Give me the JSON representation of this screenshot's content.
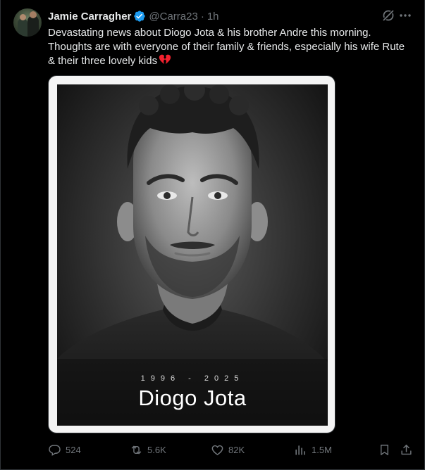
{
  "tweet": {
    "author_name": "Jamie Carragher",
    "handle": "@Carra23",
    "separator": "·",
    "time": "1h",
    "text": "Devastating news about Diogo Jota & his brother Andre this morning. Thoughts are with everyone of their family & friends, especially his wife Rute & their three lovely kids",
    "emoji": "broken-heart-icon"
  },
  "media": {
    "years": "1996 - 2025",
    "name": "Diogo Jota"
  },
  "actions": {
    "replies": "524",
    "reposts": "5.6K",
    "likes": "82K",
    "views": "1.5M"
  },
  "colors": {
    "background": "#000000",
    "text": "#e7e9ea",
    "muted": "#71767b",
    "verified": "#1d9bf0",
    "border": "#2f3336",
    "heart": "#f4212e"
  }
}
